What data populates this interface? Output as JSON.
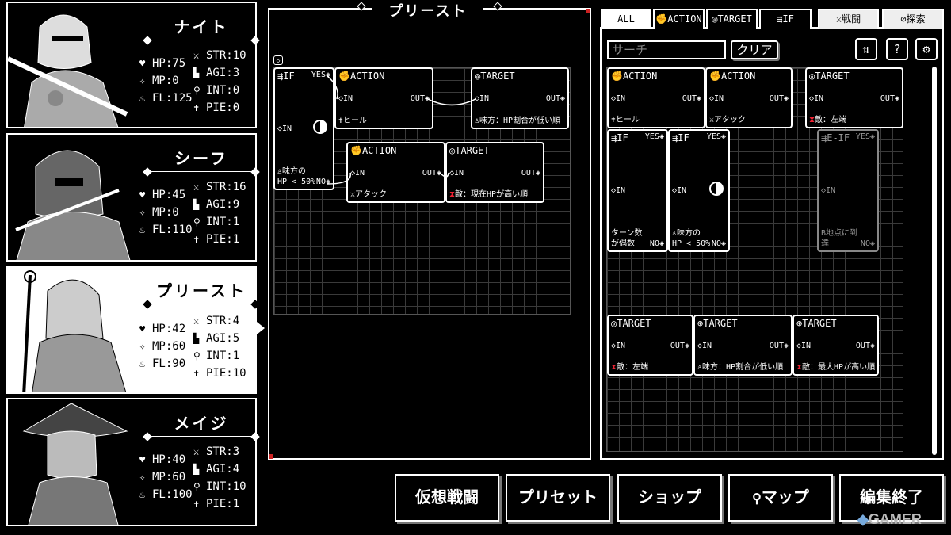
{
  "characters": [
    {
      "name": "ナイト",
      "hp": "HP:75",
      "mp": "MP:0",
      "fl": "FL:125",
      "str": "STR:10",
      "agi": "AGI:3",
      "int": "INT:0",
      "pie": "PIE:0"
    },
    {
      "name": "シーフ",
      "hp": "HP:45",
      "mp": "MP:0",
      "fl": "FL:110",
      "str": "STR:16",
      "agi": "AGI:9",
      "int": "INT:1",
      "pie": "PIE:1"
    },
    {
      "name": "プリースト",
      "hp": "HP:42",
      "mp": "MP:60",
      "fl": "FL:90",
      "str": "STR:4",
      "agi": "AGI:5",
      "int": "INT:1",
      "pie": "PIE:10"
    },
    {
      "name": "メイジ",
      "hp": "HP:40",
      "mp": "MP:60",
      "fl": "FL:100",
      "str": "STR:3",
      "agi": "AGI:4",
      "int": "INT:10",
      "pie": "PIE:1"
    }
  ],
  "editor": {
    "title": "プリースト",
    "nodes": {
      "if1": {
        "head": "IF",
        "yes": "YES",
        "in": "IN",
        "bot1": "味方の",
        "bot2": "HP < 50%",
        "no": "NO"
      },
      "act1": {
        "head": "ACTION",
        "in": "IN",
        "out": "OUT",
        "bot": "ヒール"
      },
      "tgt1": {
        "head": "TARGET",
        "in": "IN",
        "out": "OUT",
        "bot": "味方：HP割合が低い順"
      },
      "act2": {
        "head": "ACTION",
        "in": "IN",
        "out": "OUT",
        "bot": "アタック"
      },
      "tgt2": {
        "head": "TARGET",
        "in": "IN",
        "out": "OUT",
        "bot": "敵：現在HPが高い順"
      }
    }
  },
  "palette": {
    "tabs": [
      "ALL",
      "ACTION",
      "TARGET",
      "IF",
      "戦闘",
      "探索"
    ],
    "search_placeholder": "サーチ",
    "clear_label": "クリア",
    "nodes": {
      "p_act1": {
        "head": "ACTION",
        "in": "IN",
        "out": "OUT",
        "bot": "ヒール"
      },
      "p_act2": {
        "head": "ACTION",
        "in": "IN",
        "out": "OUT",
        "bot": "アタック"
      },
      "p_tgt1": {
        "head": "TARGET",
        "in": "IN",
        "out": "OUT",
        "bot": "敵：左端"
      },
      "p_if1": {
        "head": "IF",
        "yes": "YES",
        "in": "IN",
        "bot1": "ターン数",
        "bot2": "が偶数",
        "no": "NO"
      },
      "p_if2": {
        "head": "IF",
        "yes": "YES",
        "in": "IN",
        "bot1": "味方の",
        "bot2": "HP < 50%",
        "no": "NO"
      },
      "p_eif": {
        "head": "E-IF",
        "yes": "YES",
        "in": "IN",
        "bot1": "B地点に到",
        "bot2": "達",
        "no": "NO"
      },
      "p_tgt2": {
        "head": "TARGET",
        "in": "IN",
        "out": "OUT",
        "bot": "敵：左端"
      },
      "p_tgt3": {
        "head": "TARGET",
        "in": "IN",
        "out": "OUT",
        "bot": "味方：HP割合が低い順"
      },
      "p_tgt4": {
        "head": "TARGET",
        "in": "IN",
        "out": "OUT",
        "bot": "敵：最大HPが高い順"
      }
    }
  },
  "buttons": [
    "仮想戦闘",
    "プリセット",
    "ショップ",
    "マップ",
    "編集終了"
  ],
  "watermark": "GAMER",
  "colors": {
    "accent_red": "#e23",
    "grid": "#3a3a3a",
    "background": "#000000",
    "foreground": "#ffffff"
  }
}
